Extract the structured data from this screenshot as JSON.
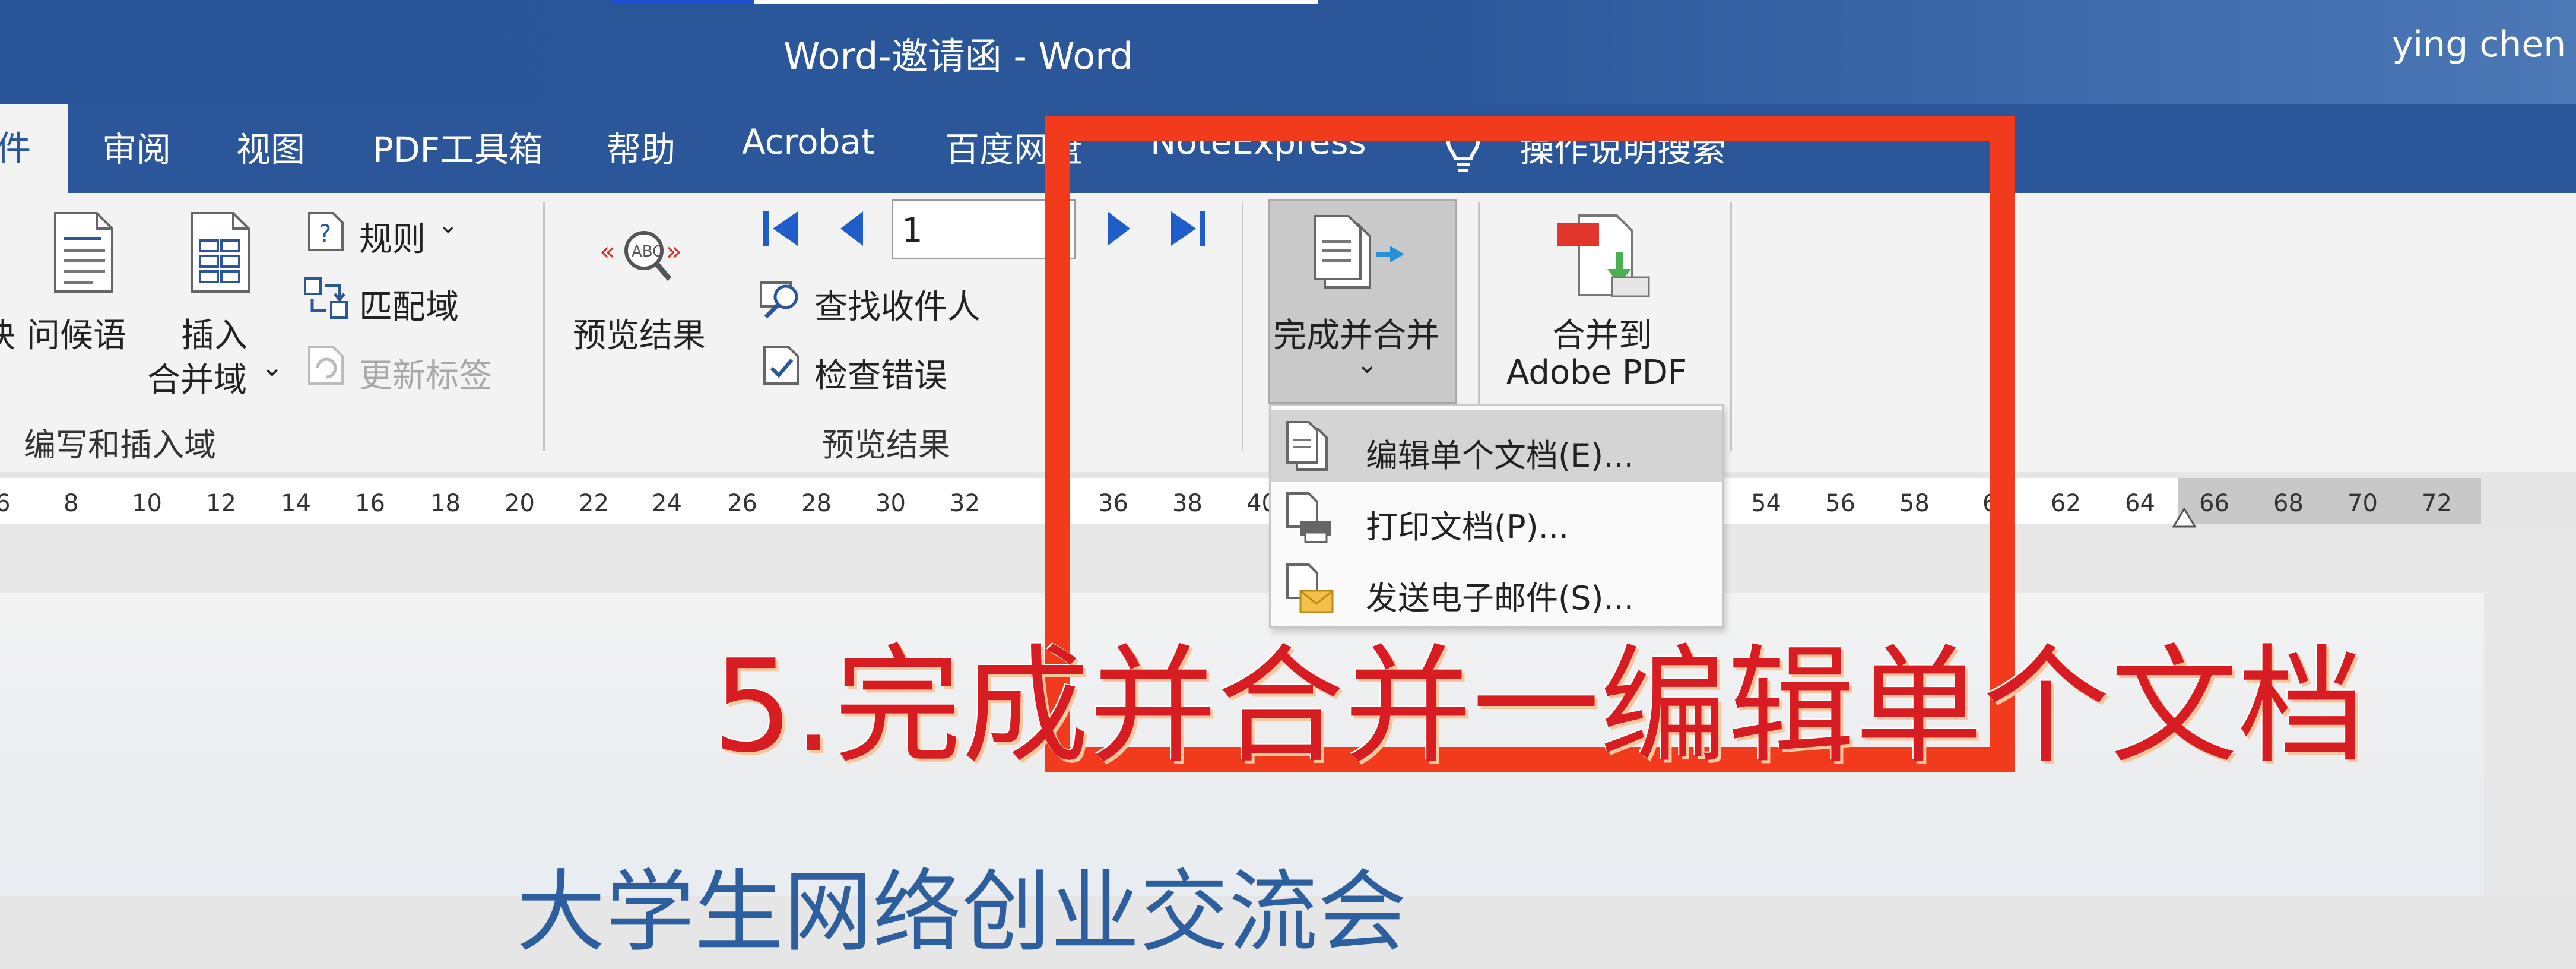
{
  "window": {
    "title": "Word-邀请函  -  Word",
    "user": "ying chen"
  },
  "tabs": {
    "active_partial": "件",
    "items": [
      "审阅",
      "视图",
      "PDF工具箱",
      "帮助",
      "Acrobat",
      "百度网盘",
      "NoteExpress",
      "操作说明搜索"
    ]
  },
  "ribbon": {
    "write_insert_group": {
      "cut_label": "块",
      "greeting": "问候语",
      "insert_line1": "插入",
      "insert_line2": "合并域",
      "rules": "规则",
      "match_fields": "匹配域",
      "update_labels": "更新标签",
      "group_label": "编写和插入域"
    },
    "preview_group": {
      "preview_results": "预览结果",
      "record_number": "1",
      "find_recipient": "查找收件人",
      "check_errors": "检查错误",
      "group_label": "预览结果"
    },
    "finish_group": {
      "finish_merge": "完成并合并",
      "merge_to_line1": "合并到",
      "merge_to_line2": "Adobe PDF"
    }
  },
  "ruler": {
    "ticks": [
      "6",
      "8",
      "10",
      "12",
      "14",
      "16",
      "18",
      "20",
      "22",
      "24",
      "26",
      "28",
      "30",
      "32",
      "36",
      "38",
      "40",
      "54",
      "56",
      "58",
      "6",
      "62",
      "64",
      "66",
      "68",
      "70",
      "72"
    ]
  },
  "menu": {
    "items": [
      {
        "label": "编辑单个文档(E)...",
        "highlighted": true
      },
      {
        "label": "打印文档(P)...",
        "highlighted": false
      },
      {
        "label": "发送电子邮件(S)...",
        "highlighted": false
      }
    ]
  },
  "document": {
    "heading_partial": "大学生网络创业交流会"
  },
  "annotation": {
    "text": "5.完成并合并一编辑单个文档",
    "color": "#d71c22",
    "box_color": "#f23a1d"
  },
  "colors": {
    "word_blue": "#2b579a",
    "ribbon_bg": "#f3f3f3",
    "nav_blue": "#1f5ec8"
  }
}
